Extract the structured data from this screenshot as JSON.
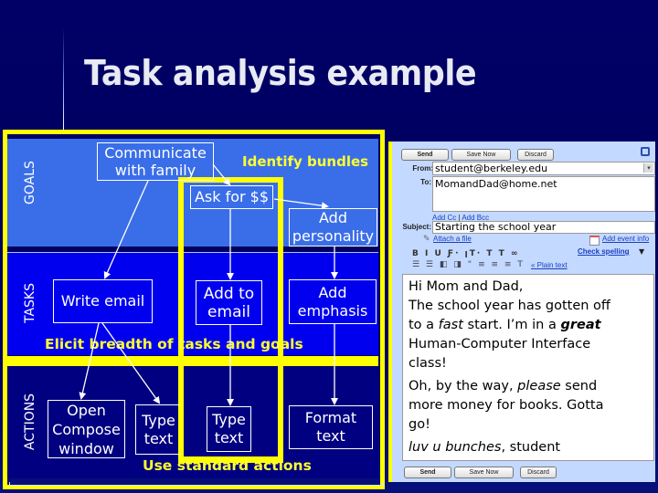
{
  "slide": {
    "title": "Task analysis example"
  },
  "diagram": {
    "levels": {
      "goals": "GOALS",
      "tasks": "TASKS",
      "actions": "ACTIONS"
    },
    "goals": {
      "communicate": [
        "Communicate",
        "with family"
      ],
      "ask_money": "Ask for $$",
      "add_personality": [
        "Add",
        "personality"
      ]
    },
    "tasks": {
      "write_email": "Write email",
      "add_to_email": [
        "Add to",
        "email"
      ],
      "add_emphasis": [
        "Add",
        "emphasis"
      ]
    },
    "actions": {
      "open_compose": [
        "Open",
        "Compose",
        "window"
      ],
      "type_text_1": [
        "Type",
        "text"
      ],
      "type_text_2": [
        "Type",
        "text"
      ],
      "format_text": [
        "Format",
        "text"
      ]
    },
    "annotations": {
      "identify_bundles": "Identify bundles",
      "elicit_breadth": "Elicit breadth of tasks and goals",
      "use_standard": "Use standard actions"
    },
    "colors": {
      "highlight": "#ffff00",
      "goals_band": "#3a6ee8",
      "tasks_band": "#0000ee",
      "actions_band": "#000080",
      "background": "#000066"
    }
  },
  "gmail": {
    "buttons": {
      "send": "Send",
      "save_now": "Save Now",
      "discard": "Discard"
    },
    "from_label": "From:",
    "from_value": "student@berkeley.edu",
    "to_label": "To:",
    "to_value": "MomandDad@home.net",
    "add_cc": "Add Cc",
    "separator": "|",
    "add_bcc": "Add Bcc",
    "subject_label": "Subject:",
    "subject_value": "Starting the school year",
    "attach_file": "Attach a file",
    "add_event": "Add event info",
    "check_spelling": "Check spelling",
    "plain_text": "« Plain text",
    "toolbar_row1": "B I U  Ƒ· ꞁT·  T  T  ∞",
    "toolbar_row2": "☰ ☰ ◧ ◨ “  ≡ ≡ ≡ T",
    "body": {
      "greeting": "Hi Mom and Dad,",
      "line1": "The school year has gotten off",
      "line2_a": "to a ",
      "line2_fast": "fast",
      "line2_b": " start. I’m in a ",
      "line2_great": "great",
      "line3": "Human-Computer Interface",
      "line4": "class!",
      "p2_a": "Oh, by the way, ",
      "p2_please": "please",
      "p2_b": " send",
      "p2_line2": "more money for books. Gotta",
      "p2_line3": "go!",
      "sign_italic": "luv u bunches",
      "sign_rest": ", student"
    }
  }
}
